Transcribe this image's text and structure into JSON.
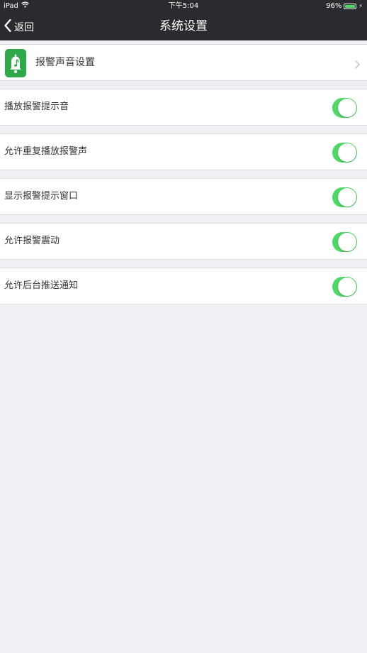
{
  "status_bar": {
    "device": "iPad",
    "time": "下午5:04",
    "battery_percent": "96%",
    "battery_level": 0.96,
    "wifi_icon": "wifi-icon",
    "charging_icon": "charging-bolt-icon"
  },
  "nav": {
    "back_label": "返回",
    "title": "系统设置"
  },
  "sound_settings": {
    "label": "报警声音设置",
    "icon": "alarm-bell-music-icon",
    "accent_color": "#2fa84a"
  },
  "toggles": [
    {
      "label": "播放报警提示音",
      "on": true
    },
    {
      "label": "允许重复播放报警声",
      "on": true
    },
    {
      "label": "显示报警提示窗口",
      "on": true
    },
    {
      "label": "允许报警震动",
      "on": true
    },
    {
      "label": "允许后台推送通知",
      "on": true
    }
  ],
  "colors": {
    "nav_background": "#2a2b2e",
    "page_background": "#efeff4",
    "toggle_on": "#4cd964"
  }
}
